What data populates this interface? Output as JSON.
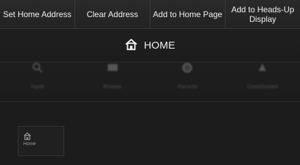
{
  "top_bar": {
    "buttons": [
      {
        "label": "Set Home Address"
      },
      {
        "label": "Clear Address"
      },
      {
        "label": "Add to Home Page"
      },
      {
        "label": "Add to Heads-Up Display"
      }
    ]
  },
  "header": {
    "title": "HOME",
    "icon": "home-icon"
  },
  "menu": {
    "items": [
      {
        "label": "Apple",
        "icon": "search-icon"
      },
      {
        "label": "Browse",
        "icon": "message-icon"
      },
      {
        "label": "Recents",
        "icon": "clock-icon"
      },
      {
        "label": "Downloaded",
        "icon": "flag-icon"
      }
    ]
  },
  "tile": {
    "label": "Home",
    "icon": "home-icon"
  },
  "colors": {
    "background": "#1b1b1b",
    "topbar": "#252525",
    "text": "#f2f2f2"
  }
}
